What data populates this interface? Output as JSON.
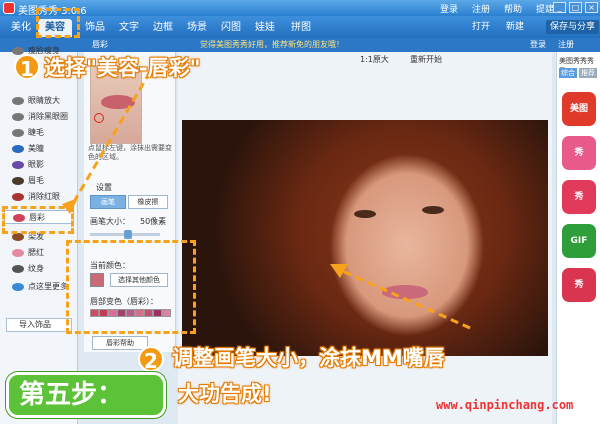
{
  "window": {
    "title": "美图秀秀 3.0.6",
    "links": [
      "登录",
      "注册",
      "帮助",
      "提建议"
    ],
    "controls": [
      "_",
      "□",
      "×"
    ]
  },
  "menu": {
    "tabs": [
      "美化",
      "美容",
      "饰品",
      "文字",
      "边框",
      "场景",
      "闪图",
      "娃娃",
      "拼图"
    ],
    "active_tab": "美容",
    "open_label": "打开",
    "new_label": "新建",
    "save_label": "保存与分享"
  },
  "subbar": {
    "tool_title": "唇彩",
    "slogan": "觉得美图秀秀好用，推荐新免的朋友哦！",
    "links": [
      "登录",
      "注册"
    ]
  },
  "sidebar": {
    "items": [
      "瘦脸瘦身",
      "眼睛放大",
      "消除黑眼圈",
      "睫毛",
      "美瞳",
      "眼影",
      "眉毛",
      "消除红眼",
      "唇彩",
      "染发",
      "腮红",
      "纹身",
      "点这里更多"
    ],
    "active_item": "唇彩",
    "import_label": "导入饰品"
  },
  "panel": {
    "thumb_label": "唇彩",
    "tip": "点鼠标左键，涂抹出需要变色的区域。",
    "settings_label": "设置",
    "brush_label": "画笔",
    "eraser_label": "橡皮擦",
    "brush_size_label": "画笔大小：",
    "brush_size_value": "50像素",
    "brush_size_fraction": 0.55,
    "current_color_label": "当前颜色：",
    "choose_color_label": "选择其他颜色",
    "preset_label": "唇部变色（唇彩）：",
    "swatch_colors": [
      "#d44a64",
      "#c23a55",
      "#e06a9a",
      "#a8406e",
      "#b85c8a",
      "#d27090",
      "#c45070",
      "#9e3060",
      "#e080a0"
    ],
    "current_color": "#c96a76",
    "help_label": "唇彩帮助"
  },
  "canvas": {
    "zoom_label": "1:1原大",
    "reset_label": "重新开始"
  },
  "rightcol": {
    "title": "美图秀秀秀秀",
    "tabs": [
      "综合",
      "推荐"
    ],
    "apps": [
      "美图",
      "秀",
      "秀",
      "GIF",
      "秀"
    ],
    "app_colors": [
      "#e03a2a",
      "#e85a8a",
      "#e23a5a",
      "#2e9e3a",
      "#d93550"
    ]
  },
  "overlay": {
    "step1_num": "1",
    "step1_text": "选择\"美容-唇彩\"",
    "step2_num": "2",
    "step2_line1": "调整画笔大小，涂抹MM嘴唇",
    "step2_line2": "大功告成!",
    "badge": "第五步：",
    "watermark": "www.qinpinchang.com"
  }
}
